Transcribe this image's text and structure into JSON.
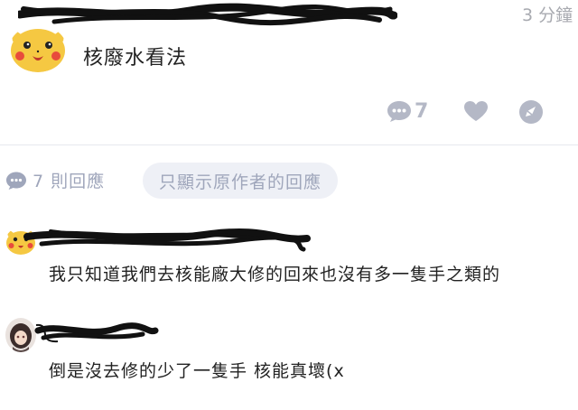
{
  "post": {
    "time": "3 分鐘",
    "content": "核廢水看法",
    "comment_count": "7"
  },
  "replies": {
    "count_label": "7 則回應",
    "op_only_label": "只顯示原作者的回應"
  },
  "comments": [
    {
      "text": "我只知道我們去核能廠大修的回來也沒有多一隻手之類的"
    },
    {
      "text": "倒是沒去修的少了一隻手 核能真壞(x"
    }
  ],
  "colors": {
    "muted": "#b4b8c6",
    "reply_muted": "#9fa6bb",
    "pill_bg": "#eef0f6",
    "pikachu": "#f5c842"
  },
  "icons": {
    "comment": "speech-bubble-icon",
    "like": "heart-icon",
    "share": "share-icon"
  }
}
